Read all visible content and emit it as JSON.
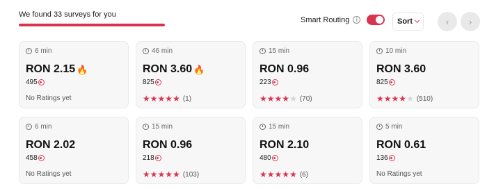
{
  "header": {
    "found_text": "We found 33 surveys for you",
    "progress": 1.0,
    "smart_routing_label": "Smart Routing",
    "smart_routing_enabled": true,
    "sort_label": "Sort",
    "prev_icon": "chevron-left-icon",
    "next_icon": "chevron-right-icon"
  },
  "colors": {
    "accent": "#d8344f",
    "card_bg": "#f7f7f7"
  },
  "surveys": [
    {
      "duration": "6 min",
      "price": "RON 2.15",
      "hot": true,
      "points": "495",
      "rating": null,
      "rating_text": "No Ratings yet",
      "rating_count": ""
    },
    {
      "duration": "46 min",
      "price": "RON 3.60",
      "hot": true,
      "points": "825",
      "rating": 5,
      "rating_text": "",
      "rating_count": "(1)"
    },
    {
      "duration": "15 min",
      "price": "RON 0.96",
      "hot": false,
      "points": "223",
      "rating": 4,
      "rating_text": "",
      "rating_count": "(70)"
    },
    {
      "duration": "10 min",
      "price": "RON 3.60",
      "hot": false,
      "points": "825",
      "rating": 4,
      "rating_text": "",
      "rating_count": "(510)"
    },
    {
      "duration": "6 min",
      "price": "RON 2.02",
      "hot": false,
      "points": "458",
      "rating": null,
      "rating_text": "No Ratings yet",
      "rating_count": ""
    },
    {
      "duration": "15 min",
      "price": "RON 0.96",
      "hot": false,
      "points": "218",
      "rating": 5,
      "rating_text": "",
      "rating_count": "(103)"
    },
    {
      "duration": "15 min",
      "price": "RON 2.10",
      "hot": false,
      "points": "480",
      "rating": 5,
      "rating_text": "",
      "rating_count": "(6)"
    },
    {
      "duration": "5 min",
      "price": "RON 0.61",
      "hot": false,
      "points": "136",
      "rating": null,
      "rating_text": "No Ratings yet",
      "rating_count": ""
    }
  ]
}
